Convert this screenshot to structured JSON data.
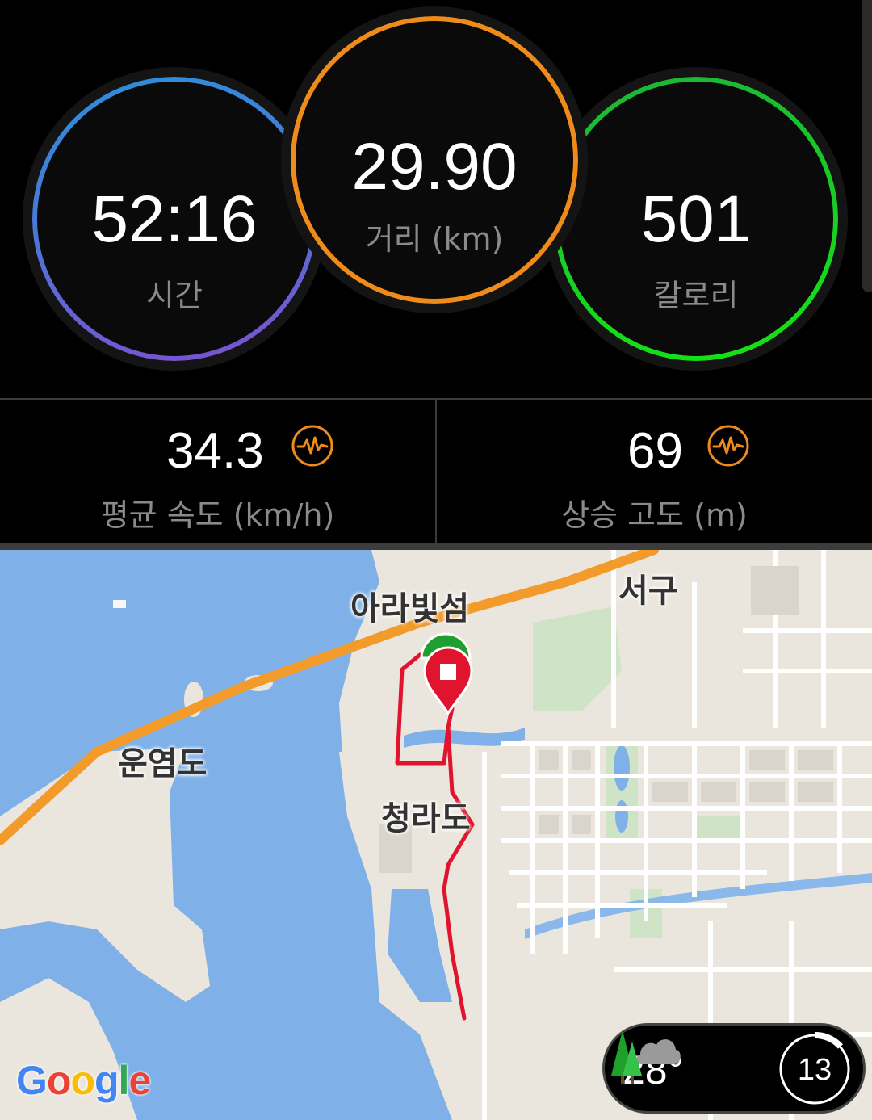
{
  "metrics": {
    "time": {
      "value": "52:16",
      "label": "시간"
    },
    "distance": {
      "value": "29.90",
      "label": "거리 (km)"
    },
    "calories": {
      "value": "501",
      "label": "칼로리"
    }
  },
  "stats": {
    "avg_speed": {
      "value": "34.3",
      "label": "평균 속도 (km/h)",
      "icon": "pulse-icon"
    },
    "elevation_gain": {
      "value": "69",
      "label": "상승 고도 (m)",
      "icon": "pulse-icon"
    }
  },
  "colors": {
    "time_ring": "#2c8fd8",
    "distance_ring": "#ee8b1b",
    "calories_ring": "#14e414",
    "route": "#e0142f",
    "water": "#7fb0e8"
  },
  "map": {
    "labels": {
      "ara": "아라빛섬",
      "seogu": "서구",
      "unyeom": "운염도",
      "cheongna": "청라도"
    },
    "attribution": "Google",
    "weather": {
      "temperature": "28°",
      "icon": "forest-cloud-icon"
    },
    "zoom_badge": "13"
  }
}
